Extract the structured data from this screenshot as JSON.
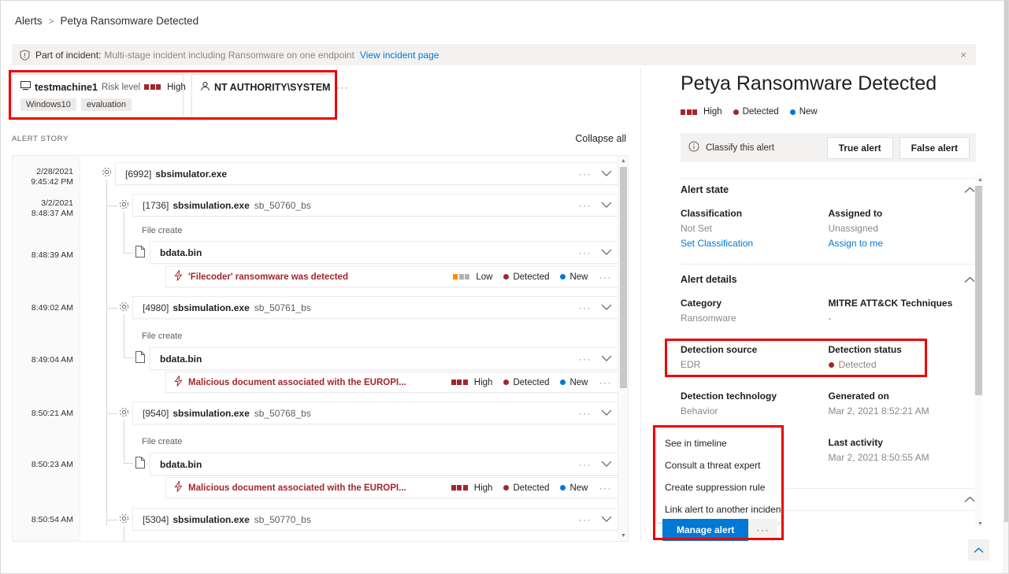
{
  "breadcrumb": {
    "root": "Alerts",
    "separator": ">",
    "current": "Petya Ransomware Detected"
  },
  "incident_banner": {
    "icon": "shield-icon",
    "label": "Part of incident:",
    "value": "Multi-stage incident including Ransomware on one endpoint",
    "link": "View incident page",
    "close": "×"
  },
  "entities": {
    "machine": {
      "icon": "device-icon",
      "name": "testmachine1",
      "risk_label": "Risk level",
      "severity": "High",
      "severity_color": "#a4262c",
      "overflow": "···",
      "tags": [
        "Windows10",
        "evaluation"
      ]
    },
    "user": {
      "icon": "user-icon",
      "name": "NT AUTHORITY\\SYSTEM",
      "overflow": "···"
    }
  },
  "alert_story": {
    "title": "ALERT STORY",
    "collapse_all": "Collapse all",
    "rows": [
      {
        "kind": "process",
        "time": [
          "2/28/2021",
          "9:45:42 PM"
        ],
        "pid": "[6992]",
        "name": "sbsimulator.exe",
        "args": "",
        "indent": 0
      },
      {
        "kind": "process",
        "time": [
          "3/2/2021",
          "8:48:37 AM"
        ],
        "pid": "[1736]",
        "name": "sbsimulation.exe",
        "args": "sb_50760_bs",
        "indent": 1
      },
      {
        "kind": "label",
        "text": "File create"
      },
      {
        "kind": "file",
        "time": [
          "8:48:39 AM"
        ],
        "name": "bdata.bin"
      },
      {
        "kind": "detection",
        "name": "'Filecoder' ransomware was detected",
        "severity": "Low",
        "status": "Detected",
        "state": "New"
      },
      {
        "kind": "process",
        "time": [
          "8:49:02 AM"
        ],
        "pid": "[4980]",
        "name": "sbsimulation.exe",
        "args": "sb_50761_bs",
        "indent": 1
      },
      {
        "kind": "label",
        "text": "File create"
      },
      {
        "kind": "file",
        "time": [
          "8:49:04 AM"
        ],
        "name": "bdata.bin"
      },
      {
        "kind": "detection",
        "name": "Malicious document associated with the EUROPI...",
        "severity": "High",
        "status": "Detected",
        "state": "New"
      },
      {
        "kind": "process",
        "time": [
          "8:50:21 AM"
        ],
        "pid": "[9540]",
        "name": "sbsimulation.exe",
        "args": "sb_50768_bs",
        "indent": 1
      },
      {
        "kind": "label",
        "text": "File create"
      },
      {
        "kind": "file",
        "time": [
          "8:50:23 AM"
        ],
        "name": "bdata.bin"
      },
      {
        "kind": "detection",
        "name": "Malicious document associated with the EUROPI...",
        "severity": "High",
        "status": "Detected",
        "state": "New"
      },
      {
        "kind": "process",
        "time": [
          "8:50:54 AM"
        ],
        "pid": "[5304]",
        "name": "sbsimulation.exe",
        "args": "sb_50770_bs",
        "indent": 1
      }
    ],
    "row_dots": "···"
  },
  "details": {
    "title": "Petya Ransomware Detected",
    "severity": "High",
    "status": "Detected",
    "state": "New",
    "classify": {
      "text": "Classify this alert",
      "true_alert": "True alert",
      "false_alert": "False alert"
    },
    "alert_state": {
      "heading": "Alert state",
      "classification_key": "Classification",
      "classification_value": "Not Set",
      "classification_link": "Set Classification",
      "assigned_key": "Assigned to",
      "assigned_value": "Unassigned",
      "assigned_link": "Assign to me"
    },
    "alert_details": {
      "heading": "Alert details",
      "category_key": "Category",
      "category_value": "Ransomware",
      "mitre_key": "MITRE ATT&CK Techniques",
      "mitre_value": "-",
      "detection_source_key": "Detection source",
      "detection_source_value": "EDR",
      "detection_status_key": "Detection status",
      "detection_status_value": "Detected",
      "detection_tech_key": "Detection technology",
      "detection_tech_value": "Behavior",
      "generated_key": "Generated on",
      "generated_value": "Mar 2, 2021 8:52:21 AM",
      "last_activity_key": "Last activity",
      "last_activity_value": "Mar 2, 2021 8:50:55 AM"
    }
  },
  "context_menu": {
    "items": [
      "See in timeline",
      "Consult a threat expert",
      "Create suppression rule",
      "Link alert to another incident"
    ]
  },
  "manage": {
    "label": "Manage alert",
    "dots": "···"
  },
  "colors": {
    "accent": "#0078d4",
    "severity_high": "#a4262c",
    "severity_low": "#ff8c00",
    "severity_empty": "#b3b3b3",
    "status_detected": "#a4262c",
    "state_new": "#0078d4",
    "annotation": "#ee0000"
  },
  "back_to_top": "back-to-top-icon"
}
